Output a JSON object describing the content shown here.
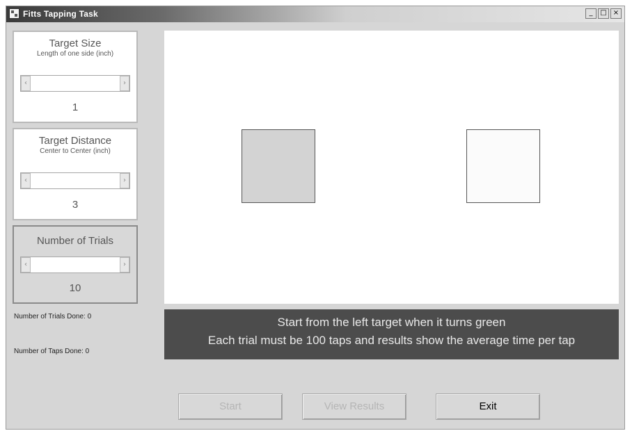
{
  "window": {
    "title": "Fitts Tapping Task",
    "controls": [
      "_",
      "□",
      "×"
    ]
  },
  "panels": {
    "target_size": {
      "title": "Target Size",
      "subtitle": "Length of one side (inch)",
      "value": "1"
    },
    "target_distance": {
      "title": "Target Distance",
      "subtitle": "Center to Center (inch)",
      "value": "3"
    },
    "num_trials": {
      "title": "Number of Trials",
      "value": "10"
    }
  },
  "scroll_arrows": {
    "left": "‹",
    "right": "›"
  },
  "status": {
    "trials_done": "Number of Trials Done: 0",
    "taps_done": "Number of Taps Done: 0"
  },
  "instructions": {
    "line1": "Start from the left target when it turns green",
    "line2": "Each trial must be 100 taps and results show the average time per tap"
  },
  "buttons": {
    "start": "Start",
    "view_results": "View Results",
    "exit": "Exit"
  },
  "colors": {
    "left_target": "#d3d3d3",
    "right_target": "#fbfbfb",
    "instructions_bg": "#4c4c4c"
  }
}
